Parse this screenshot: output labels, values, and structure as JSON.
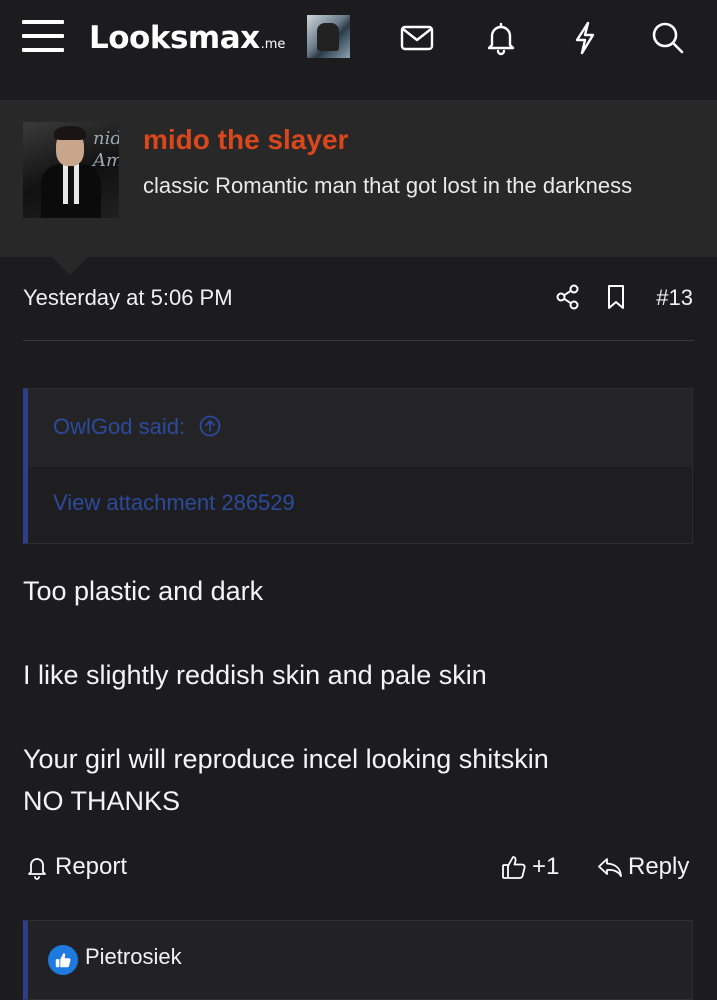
{
  "header": {
    "logo_main": "Looksmax",
    "logo_tld": ".me",
    "icons": [
      "menu-icon",
      "user-avatar",
      "envelope-icon",
      "bell-icon",
      "lightning-icon",
      "search-icon"
    ]
  },
  "member": {
    "name": "mido the slayer",
    "title": "classic Romantic man that got lost in the darkness",
    "name_color": "#d9471c"
  },
  "post": {
    "date": "Yesterday at 5:06 PM",
    "number": "#13",
    "quote": {
      "author": "OwlGod said:",
      "attachment": "View attachment 286529"
    },
    "body": [
      "Too plastic and dark",
      "I like slightly reddish skin and pale skin",
      "Your girl will reproduce incel looking shitskin",
      "NO THANKS"
    ],
    "actions": {
      "report": "Report",
      "like_count": "+1",
      "reply": "Reply"
    },
    "reactions": {
      "user": "Pietrosiek",
      "icon": "thumbs-up-icon"
    }
  },
  "colors": {
    "background": "#1c1c1e",
    "panel": "#282829",
    "link": "#2b4a9a",
    "quote_border": "#2c3f88",
    "accent": "#d9471c",
    "like_badge": "#1f7ae0"
  }
}
